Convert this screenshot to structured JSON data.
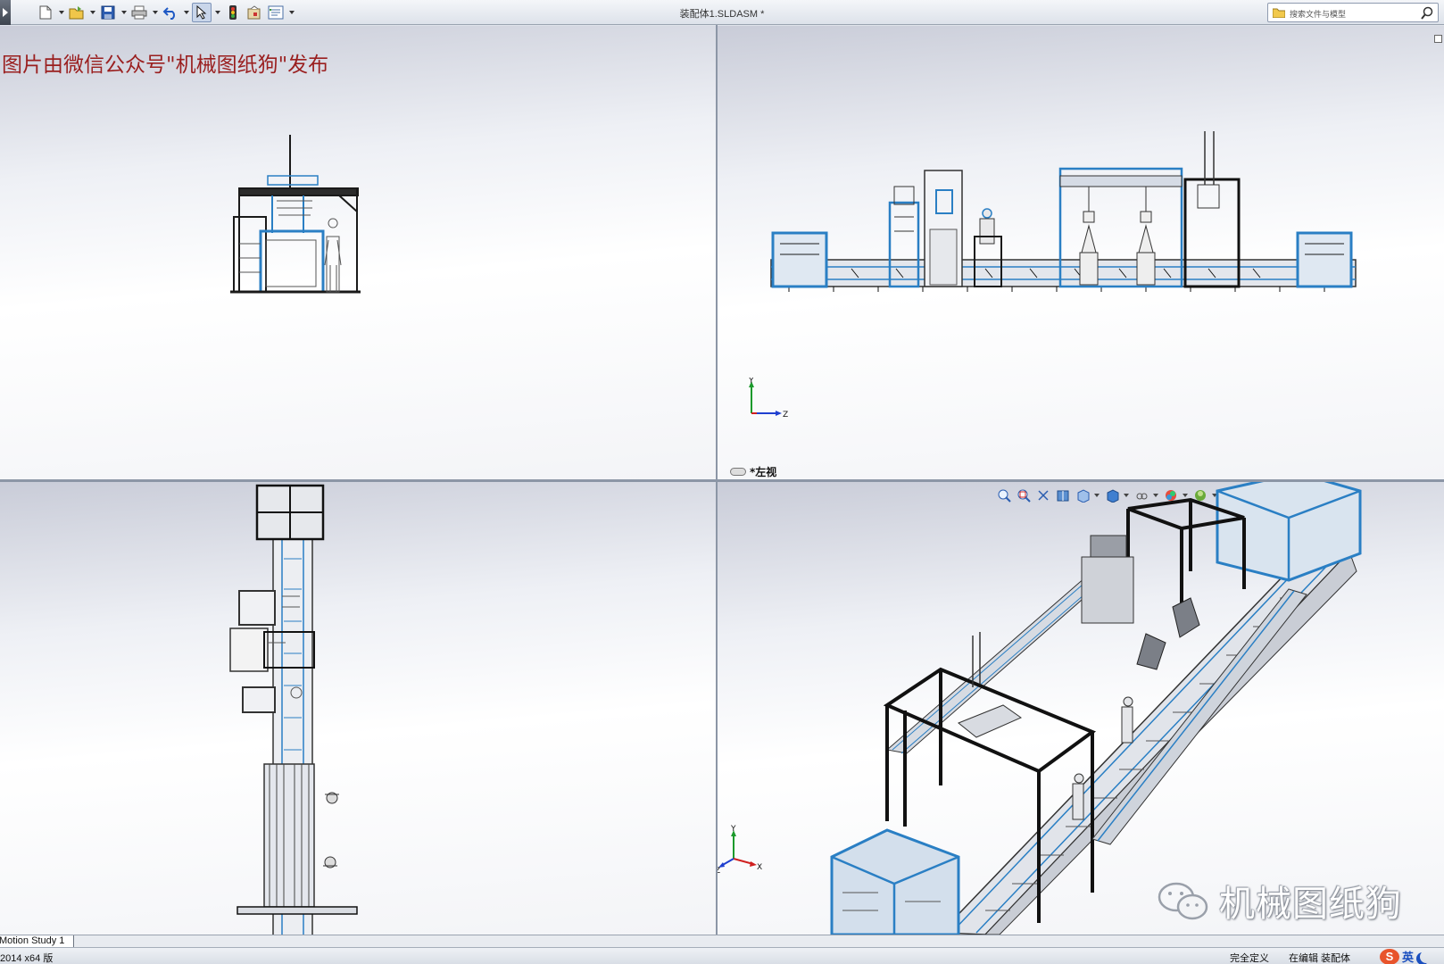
{
  "window": {
    "document_title": "装配体1.SLDASM *",
    "search_placeholder": "搜索文件与模型"
  },
  "toolbar": {
    "buttons": [
      "new-document",
      "open",
      "save",
      "print",
      "undo",
      "select",
      "rebuild",
      "options",
      "file-properties"
    ]
  },
  "viewports": {
    "top_left": {
      "watermark": "图片由微信公众号\"机械图纸狗\"发布"
    },
    "top_right": {
      "view_label": "*左视",
      "triad": {
        "up": "Y",
        "right": "Z"
      }
    },
    "bottom_left": {},
    "bottom_right": {
      "triad": {
        "up": "Y",
        "left": "Z",
        "right": "X"
      },
      "brand_text": "机械图纸狗",
      "heads_up_toolbar": [
        "zoom-to-fit",
        "zoom-to-area",
        "previous-view",
        "section-view",
        "view-orientation",
        "display-style",
        "hide-show-items",
        "edit-appearance",
        "apply-scene",
        "view-settings"
      ]
    }
  },
  "tabs": {
    "motion_study": "Motion Study 1"
  },
  "status": {
    "version": "2014 x64 版",
    "definition": "完全定义",
    "mode": "在编辑 装配体",
    "ime_logo": "S",
    "ime_lang": "英"
  },
  "colors": {
    "frame_blue": "#2a7fc4",
    "frame_dark": "#1a1a1a",
    "watermark_red": "#9a1f1f"
  }
}
